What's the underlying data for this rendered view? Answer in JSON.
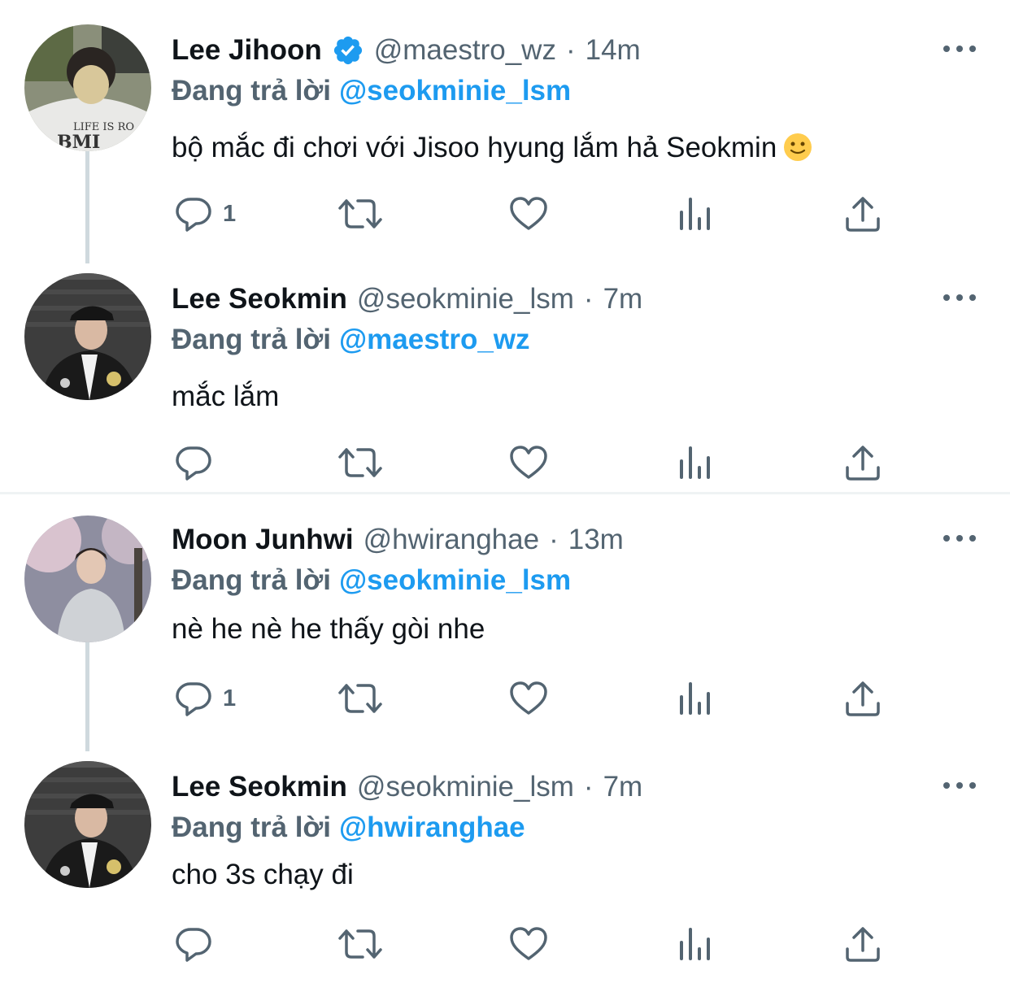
{
  "tweets": [
    {
      "name": "Lee Jihoon",
      "verified": true,
      "handle": "@maestro_wz",
      "separator": "·",
      "time": "14m",
      "reply_prefix": "Đang trả lời",
      "reply_to": "@seokminie_lsm",
      "text": "bộ mắc đi chơi với Jisoo hyung lắm hả Seokmin",
      "emoji": "slightly-smiling-face-emoji",
      "reply_count": "1",
      "avatar_shirt_text": "LIFE IS RO",
      "avatar_shirt_text2": "BMI"
    },
    {
      "name": "Lee Seokmin",
      "verified": false,
      "handle": "@seokminie_lsm",
      "separator": "·",
      "time": "7m",
      "reply_prefix": "Đang trả lời",
      "reply_to": "@maestro_wz",
      "text": "mắc lắm",
      "reply_count": ""
    },
    {
      "name": "Moon Junhwi",
      "verified": false,
      "handle": "@hwiranghae",
      "separator": "·",
      "time": "13m",
      "reply_prefix": "Đang trả lời",
      "reply_to": "@seokminie_lsm",
      "text": "nè he nè he thấy gòi nhe",
      "reply_count": "1"
    },
    {
      "name": "Lee Seokmin",
      "verified": false,
      "handle": "@seokminie_lsm",
      "separator": "·",
      "time": "7m",
      "reply_prefix": "Đang trả lời",
      "reply_to": "@hwiranghae",
      "text": "cho 3s chạy đi",
      "reply_count": ""
    }
  ],
  "icons": {
    "more": "more-dots-icon",
    "reply": "reply-bubble-icon",
    "retweet": "retweet-icon",
    "like": "heart-icon",
    "views": "views-bar-chart-icon",
    "share": "share-upload-icon",
    "verified": "verified-badge-icon"
  },
  "colors": {
    "accent": "#1d9bf0",
    "secondary_text": "#536471",
    "primary_text": "#0f1419",
    "thread_line": "#cfd9de",
    "divider": "#eff3f4"
  }
}
